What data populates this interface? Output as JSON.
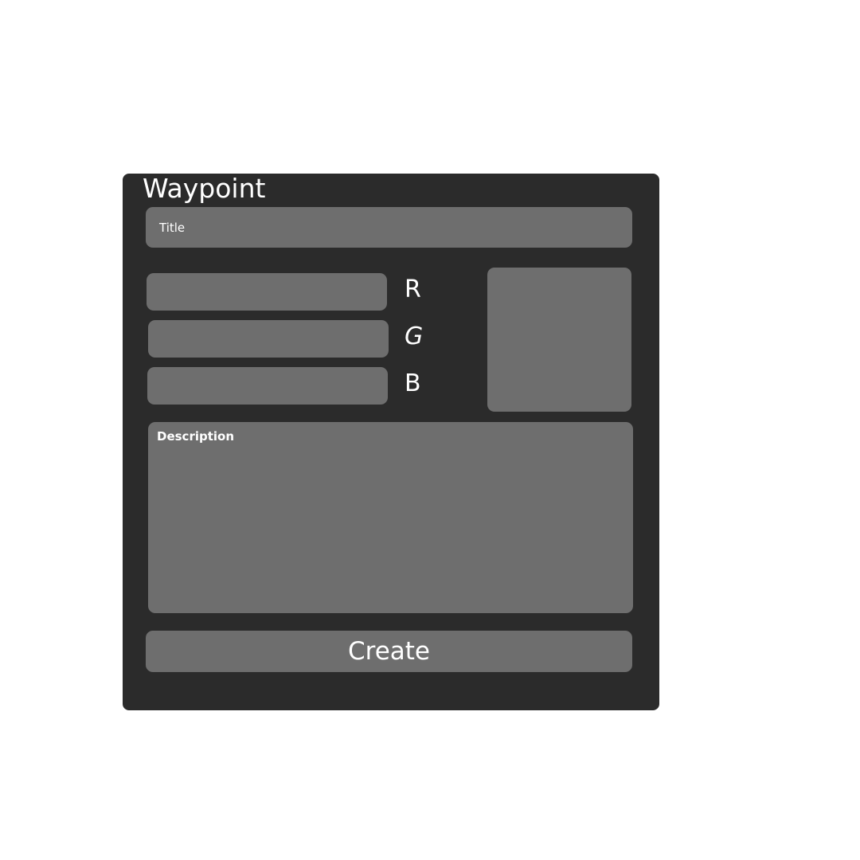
{
  "dialog": {
    "title": "Waypoint",
    "title_placeholder": "Title",
    "rgb": {
      "r_label": "R",
      "g_label": "G",
      "b_label": "B",
      "r_value": "",
      "g_value": "",
      "b_value": ""
    },
    "description_placeholder": "Description",
    "create_label": "Create"
  },
  "colors": {
    "background": "#ffffff",
    "panel": "#2b2b2b",
    "field": "#6e6e6e",
    "text": "#ffffff"
  }
}
